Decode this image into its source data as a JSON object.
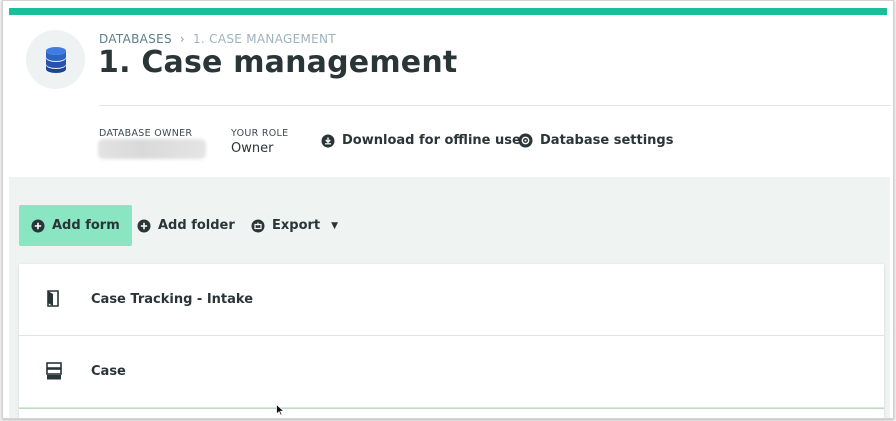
{
  "breadcrumb": {
    "root": "DATABASES",
    "separator": "›",
    "current": "1. CASE MANAGEMENT"
  },
  "page": {
    "title": "1. Case management",
    "accent_color": "#1cbe9a"
  },
  "meta": {
    "owner_label": "DATABASE OWNER",
    "role_label": "YOUR ROLE",
    "role_value": "Owner",
    "download_label": "Download for offline use",
    "settings_label": "Database settings"
  },
  "toolbar": {
    "add_form_label": "Add form",
    "add_folder_label": "Add folder",
    "export_label": "Export",
    "primary_color": "#8ae5c3"
  },
  "items": [
    {
      "label": "Case Tracking - Intake",
      "icon": "form-icon"
    },
    {
      "label": "Case",
      "icon": "subform-icon"
    }
  ]
}
